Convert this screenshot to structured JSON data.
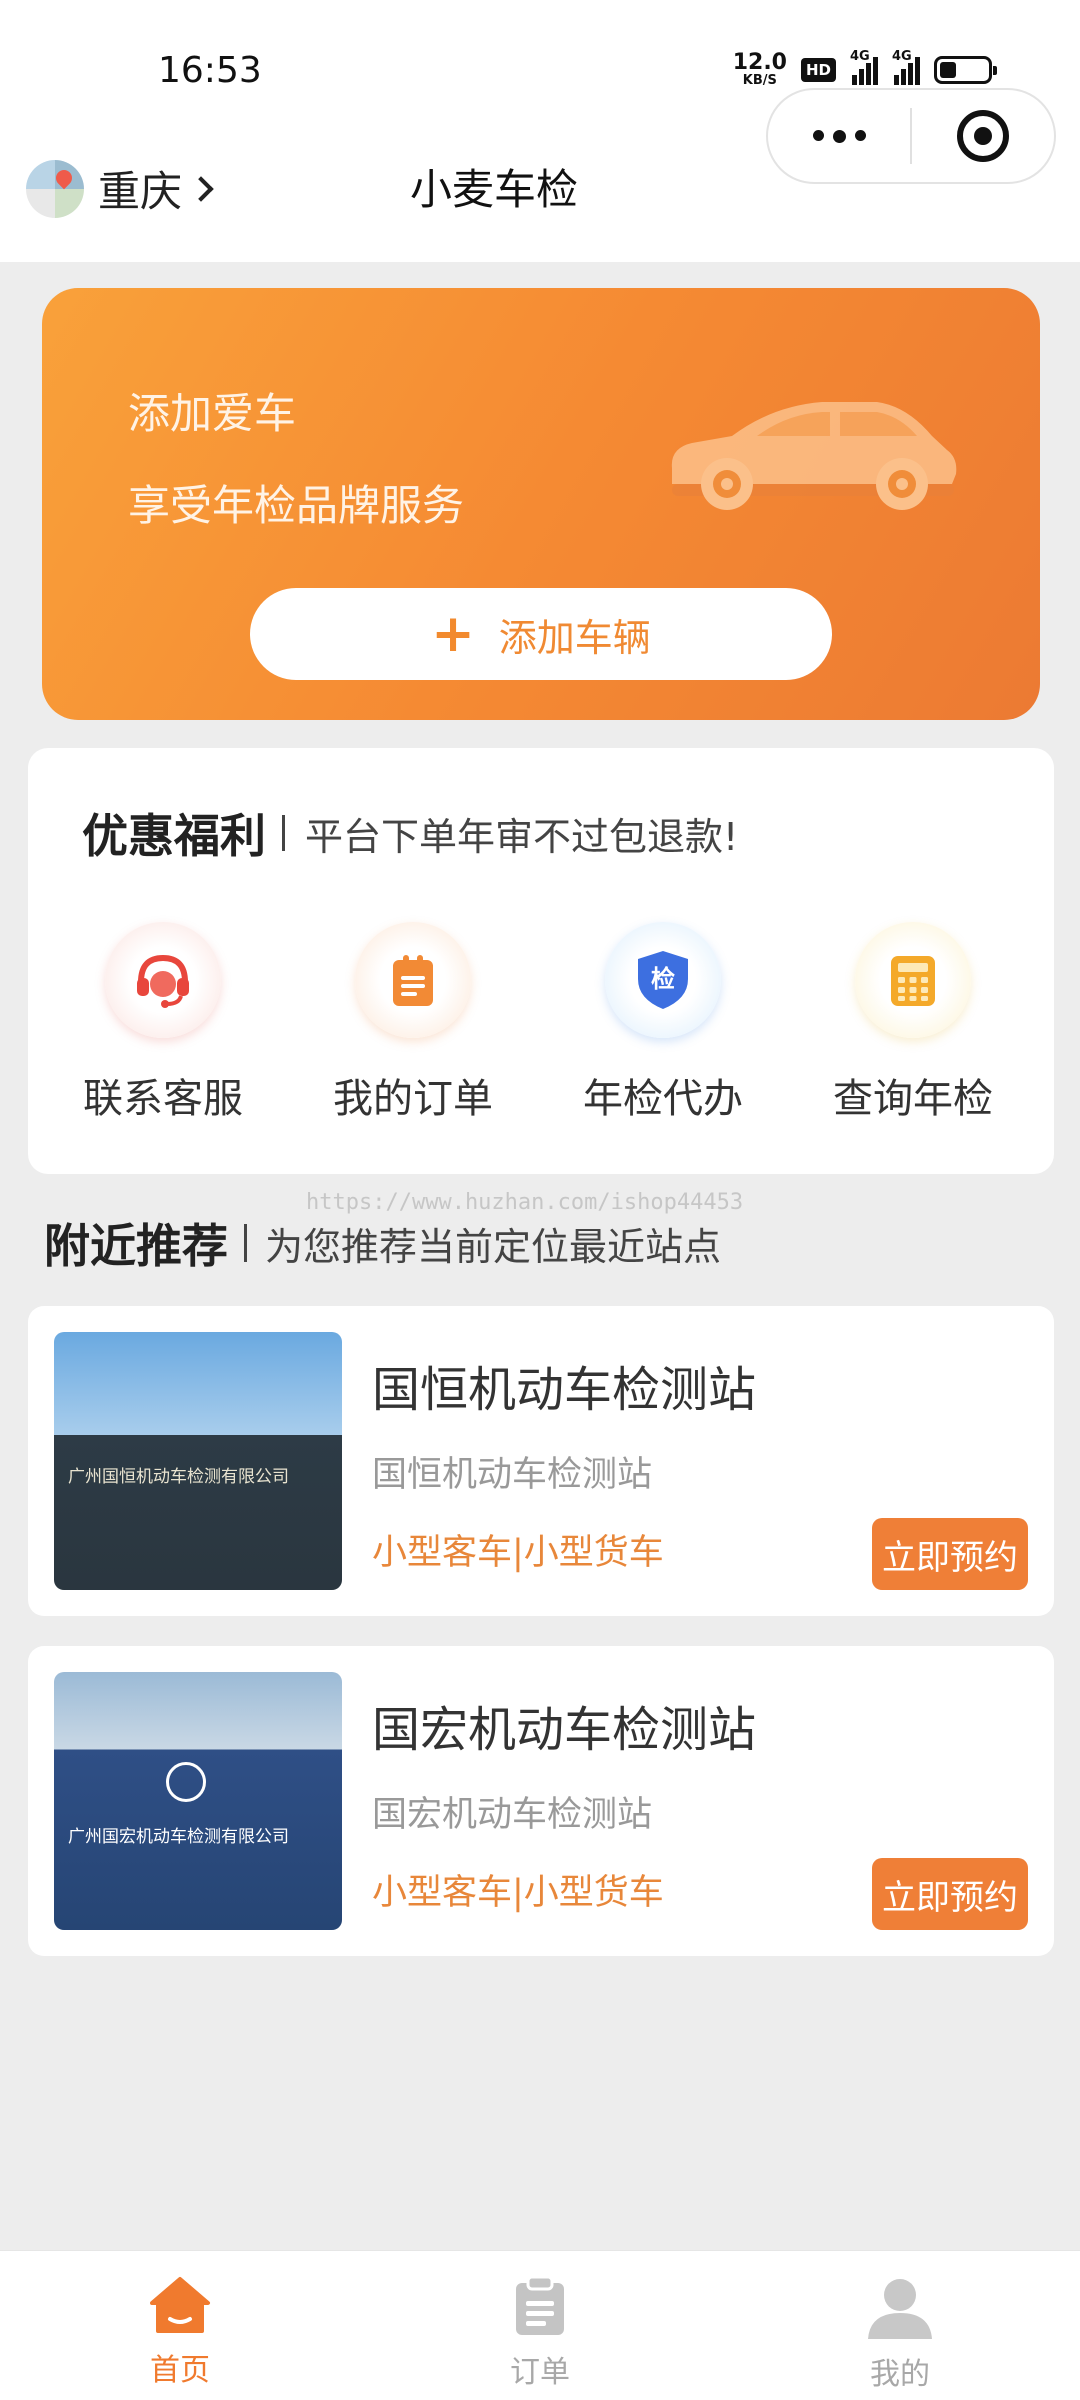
{
  "status_bar": {
    "time": "16:53",
    "net_speed_value": "12.0",
    "net_speed_unit": "KB/S",
    "hd_badge": "HD",
    "sim1_label": "4G",
    "sim2_label": "4G",
    "battery_level": 0.35
  },
  "nav": {
    "city": "重庆",
    "title": "小麦车检"
  },
  "hero": {
    "title": "添加爱车",
    "subtitle": "享受年检品牌服务",
    "add_button_label": "添加车辆",
    "colors": {
      "start": "#f9a13a",
      "end": "#ec7a33"
    }
  },
  "welfare": {
    "title": "优惠福利",
    "subtitle": "平台下单年审不过包退款!",
    "items": [
      {
        "label": "联系客服",
        "icon": "headset-icon"
      },
      {
        "label": "我的订单",
        "icon": "clipboard-icon"
      },
      {
        "label": "年检代办",
        "icon": "shield-check-icon",
        "icon_text": "检"
      },
      {
        "label": "查询年检",
        "icon": "calculator-icon"
      }
    ]
  },
  "watermark": "https://www.huzhan.com/ishop44453",
  "nearby": {
    "title": "附近推荐",
    "subtitle": "为您推荐当前定位最近站点",
    "stations": [
      {
        "name": "国恒机动车检测站",
        "desc": "国恒机动车检测站",
        "types": "小型客车|小型货车",
        "button": "立即预约",
        "photo_sign": "广州国恒机动车检测有限公司"
      },
      {
        "name": "国宏机动车检测站",
        "desc": "国宏机动车检测站",
        "types": "小型客车|小型货车",
        "button": "立即预约",
        "photo_sign": "广州国宏机动车检测有限公司"
      }
    ]
  },
  "tabs": [
    {
      "label": "首页",
      "icon": "home-icon",
      "active": true
    },
    {
      "label": "订单",
      "icon": "order-icon",
      "active": false
    },
    {
      "label": "我的",
      "icon": "user-icon",
      "active": false
    }
  ],
  "accent_color": "#f07a2e"
}
